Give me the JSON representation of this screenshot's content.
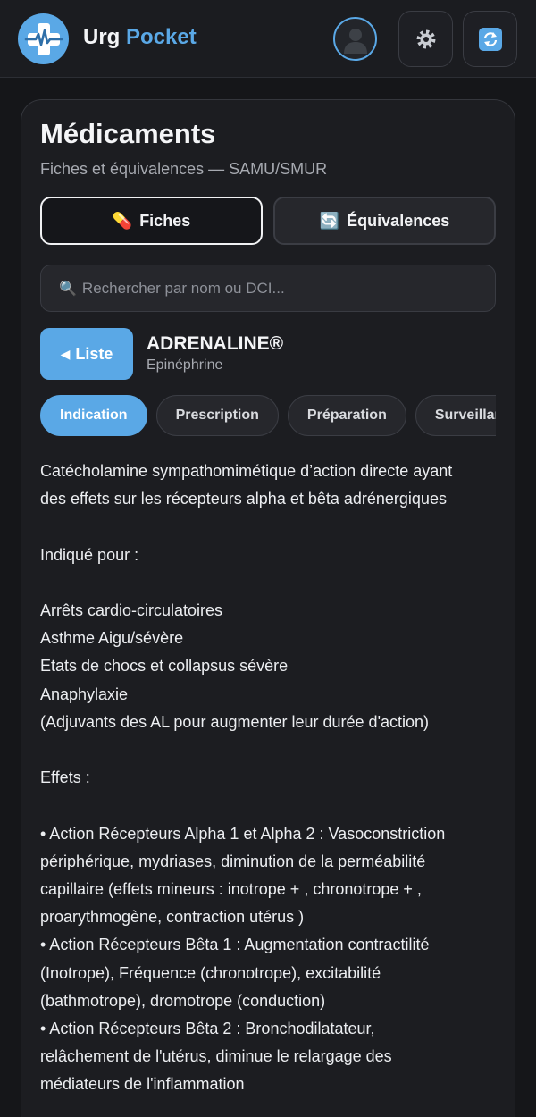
{
  "header": {
    "app_title_part1": "Urg",
    "app_title_part2": "Pocket",
    "logo_icon": "medical-cross-ecg-icon",
    "avatar_icon": "user-silhouette-icon",
    "settings_icon": "gear-icon",
    "refresh_icon": "refresh-icon"
  },
  "page": {
    "title": "Médicaments",
    "subtitle": "Fiches et équivalences — SAMU/SMUR"
  },
  "segments": [
    {
      "emoji": "💊",
      "label": "Fiches",
      "active": true
    },
    {
      "emoji": "🔄",
      "label": "Équivalences",
      "active": false
    }
  ],
  "search": {
    "icon": "🔍",
    "placeholder": "Rechercher par nom ou DCI..."
  },
  "drug": {
    "back_label": "Liste",
    "name": "ADRENALINE®",
    "dci": "Epinéphrine"
  },
  "tabs": [
    {
      "label": "Indication",
      "active": true
    },
    {
      "label": "Prescription",
      "active": false
    },
    {
      "label": "Préparation",
      "active": false
    },
    {
      "label": "Surveillance",
      "active": false
    }
  ],
  "content_lines": [
    "Catécholamine sympathomimétique d’action directe ayant",
    "des effets sur les récepteurs alpha et bêta adrénergiques",
    "",
    "Indiqué pour :",
    "",
    "Arrêts cardio-circulatoires",
    "Asthme Aigu/sévère",
    "Etats de chocs et collapsus sévère",
    "Anaphylaxie",
    "(Adjuvants des AL pour augmenter leur durée d'action)",
    "",
    "Effets :",
    "",
    "• Action Récepteurs Alpha 1 et Alpha 2 : Vasoconstriction",
    "périphérique, mydriases, diminution de la perméabilité",
    "capillaire (effets mineurs : inotrope + , chronotrope + ,",
    "proarythmogène, contraction utérus )",
    "• Action Récepteurs Bêta 1 : Augmentation contractilité",
    "(Inotrope), Fréquence (chronotrope), excitabilité",
    "(bathmotrope), dromotrope (conduction)",
    "• Action Récepteurs Bêta 2 : Bronchodilatateur,",
    "relâchement de l'utérus, diminue le relargage des",
    "médiateurs de l'inflammation"
  ],
  "colors": {
    "accent": "#5aa8e6",
    "background": "#151619",
    "card": "#1c1d21"
  }
}
